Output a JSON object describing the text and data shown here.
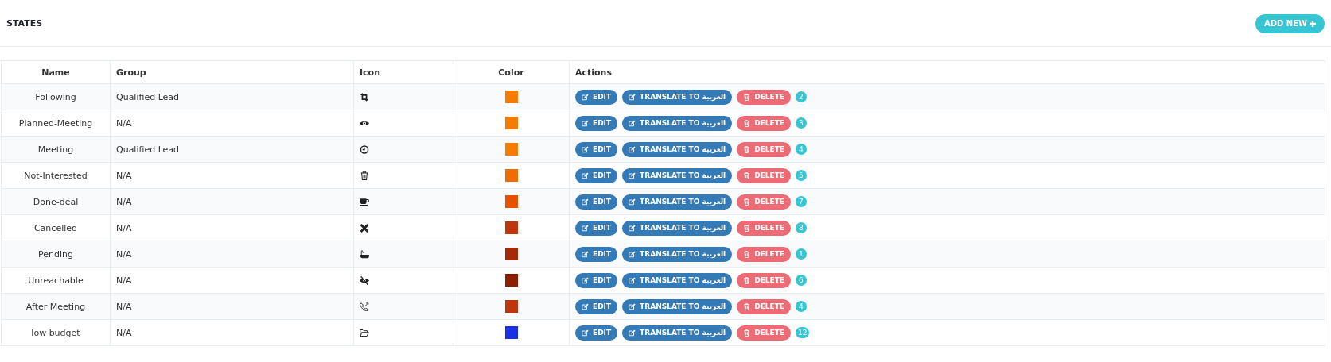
{
  "page": {
    "title": "STATES",
    "add_button": "ADD NEW"
  },
  "table": {
    "columns": [
      "Name",
      "Group",
      "Icon",
      "Color",
      "Actions"
    ],
    "rows": [
      {
        "name": "Following",
        "group": "Qualified Lead",
        "color": "#f57c00",
        "actions": [
          {
            "kind": "edit",
            "label": "EDIT"
          },
          {
            "kind": "translate",
            "label": "TRANSLATE TO العربية"
          },
          {
            "kind": "delete",
            "label": "DELETE"
          }
        ],
        "count": "2"
      },
      {
        "name": "Planned-Meeting",
        "group": "N/A",
        "color": "#f57c00",
        "actions": [
          {
            "kind": "edit",
            "label": "EDIT"
          },
          {
            "kind": "translate",
            "label": "TRANSLATE TO العربية"
          },
          {
            "kind": "delete",
            "label": "DELETE"
          }
        ],
        "count": "3"
      },
      {
        "name": "Meeting",
        "group": "Qualified Lead",
        "color": "#f57c00",
        "actions": [
          {
            "kind": "edit",
            "label": "EDIT"
          },
          {
            "kind": "translate",
            "label": "TRANSLATE TO العربية"
          },
          {
            "kind": "delete",
            "label": "DELETE"
          }
        ],
        "count": "4"
      },
      {
        "name": "Not-Interested",
        "group": "N/A",
        "color": "#ef6c00",
        "actions": [
          {
            "kind": "edit",
            "label": "EDIT"
          },
          {
            "kind": "translate",
            "label": "TRANSLATE TO العربية"
          },
          {
            "kind": "delete",
            "label": "DELETE"
          }
        ],
        "count": "5"
      },
      {
        "name": "Done-deal",
        "group": "N/A",
        "color": "#e65100",
        "actions": [
          {
            "kind": "edit",
            "label": "EDIT"
          },
          {
            "kind": "translate",
            "label": "TRANSLATE TO العربية"
          },
          {
            "kind": "delete",
            "label": "DELETE"
          }
        ],
        "count": "7"
      },
      {
        "name": "Cancelled",
        "group": "N/A",
        "color": "#bf360c",
        "actions": [
          {
            "kind": "edit",
            "label": "EDIT"
          },
          {
            "kind": "translate",
            "label": "TRANSLATE TO العربية"
          },
          {
            "kind": "delete",
            "label": "DELETE"
          }
        ],
        "count": "8"
      },
      {
        "name": "Pending",
        "group": "N/A",
        "color": "#a52a0a",
        "actions": [
          {
            "kind": "edit",
            "label": "EDIT"
          },
          {
            "kind": "translate",
            "label": "TRANSLATE TO العربية"
          },
          {
            "kind": "delete",
            "label": "DELETE"
          }
        ],
        "count": "1"
      },
      {
        "name": "Unreachable",
        "group": "N/A",
        "color": "#8b1f00",
        "actions": [
          {
            "kind": "edit",
            "label": "EDIT"
          },
          {
            "kind": "translate",
            "label": "TRANSLATE TO العربية"
          },
          {
            "kind": "delete",
            "label": "DELETE"
          }
        ],
        "count": "6"
      },
      {
        "name": "After Meeting",
        "group": "N/A",
        "color": "#bf360c",
        "actions": [
          {
            "kind": "edit",
            "label": "EDIT"
          },
          {
            "kind": "translate",
            "label": "TRANSLATE TO العربية"
          },
          {
            "kind": "delete",
            "label": "DELETE"
          }
        ],
        "count": "4"
      },
      {
        "name": "low budget",
        "group": "N/A",
        "color": "#1a2ee8",
        "actions": [
          {
            "kind": "edit",
            "label": "EDIT"
          },
          {
            "kind": "translate",
            "label": "TRANSLATE TO العربية"
          },
          {
            "kind": "delete",
            "label": "DELETE"
          }
        ],
        "count": "12"
      }
    ]
  }
}
